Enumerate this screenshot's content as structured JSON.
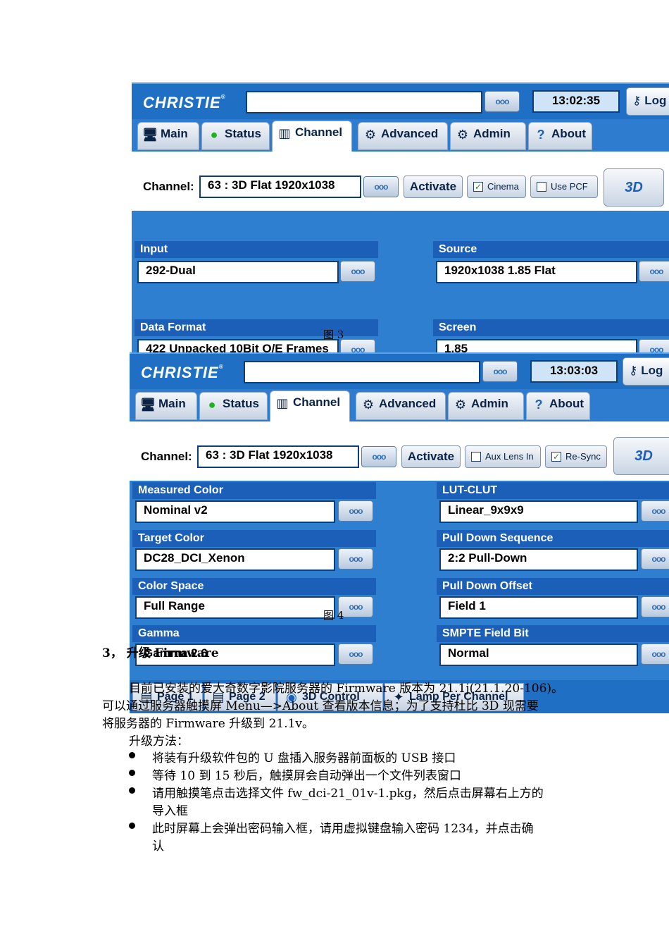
{
  "screen1": {
    "logo": "CHRISTIE",
    "clock": "13:02:35",
    "login": "Log",
    "tabs": [
      "Main",
      "Status",
      "Channel",
      "Advanced",
      "Admin",
      "About"
    ],
    "active_tab": "Channel",
    "channel_label": "Channel:",
    "channel_value": "63 : 3D Flat 1920x1038",
    "activate": "Activate",
    "checkbox1": {
      "label": "Cinema",
      "checked": true
    },
    "checkbox2": {
      "label": "Use PCF",
      "checked": false
    },
    "btn3d": "3D",
    "groups": [
      {
        "title": "Input",
        "value": "292-Dual"
      },
      {
        "title": "Source",
        "value": "1920x1038 1.85 Flat"
      },
      {
        "title": "Data Format",
        "value": "422 Unpacked 10Bit O/E Frames"
      },
      {
        "title": "Screen",
        "value": "1.85"
      }
    ],
    "more": "ooo"
  },
  "caption3": "图 3",
  "screen2": {
    "logo": "CHRISTIE",
    "clock": "13:03:03",
    "login": "Log",
    "tabs": [
      "Main",
      "Status",
      "Channel",
      "Advanced",
      "Admin",
      "About"
    ],
    "active_tab": "Channel",
    "channel_label": "Channel:",
    "channel_value": "63 : 3D Flat 1920x1038",
    "activate": "Activate",
    "checkbox1": {
      "label": "Aux Lens In",
      "checked": false
    },
    "checkbox2": {
      "label": "Re-Sync",
      "checked": true
    },
    "btn3d": "3D",
    "left_groups": [
      {
        "title": "Measured Color",
        "value": "Nominal v2"
      },
      {
        "title": "Target Color",
        "value": "DC28_DCI_Xenon"
      },
      {
        "title": "Color Space",
        "value": "Full Range"
      },
      {
        "title": "Gamma",
        "value": "Gamma 2.6"
      }
    ],
    "right_groups": [
      {
        "title": "LUT-CLUT",
        "value": "Linear_9x9x9"
      },
      {
        "title": "Pull Down Sequence",
        "value": "2:2 Pull-Down"
      },
      {
        "title": "Pull Down Offset",
        "value": "Field 1"
      },
      {
        "title": "SMPTE Field Bit",
        "value": "Normal"
      }
    ],
    "bottom_tabs": [
      "Page 1",
      "Page 2",
      "3D Control",
      "Lamp Per Channel"
    ],
    "more": "ooo"
  },
  "caption4": "图 4",
  "doc": {
    "heading": "3，  升级 Firmware",
    "para1": "目前已安装的爱大奇数字影院服务器的 Firmware 版本为 21.1j(21.1.20-106)。",
    "para2": "可以通过服务器触摸屏 Menu—>About 查看版本信息；为了支持杜比 3D 现需要",
    "para3": "将服务器的 Firmware 升级到 21.1v。",
    "method": "升级方法：",
    "bullets": [
      "将装有升级软件包的 U 盘插入服务器前面板的 USB 接口",
      "等待 10 到 15 秒后，触摸屏会自动弹出一个文件列表窗口",
      "请用触摸笔点击选择文件 fw_dci-21_01v-1.pkg，然后点击屏幕右上方的",
      "此时屏幕上会弹出密码输入框，请用虚拟键盘输入密码 1234，并点击确"
    ],
    "bullet3_cont": "导入框",
    "bullet4_cont": "认"
  }
}
